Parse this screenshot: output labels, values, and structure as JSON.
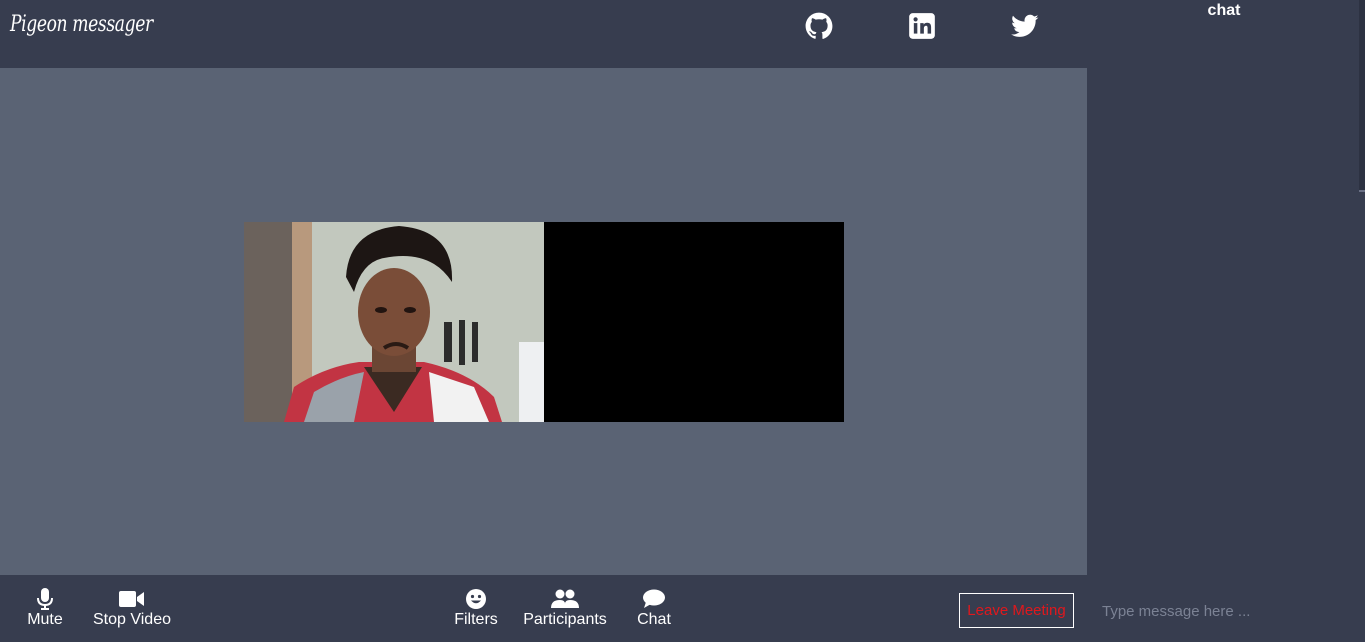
{
  "header": {
    "brand": "Pigeon messager",
    "social": [
      {
        "name": "github-icon"
      },
      {
        "name": "linkedin-icon"
      },
      {
        "name": "twitter-icon"
      }
    ]
  },
  "chat": {
    "title": "chat",
    "placeholder": "Type message here ..."
  },
  "toolbar": {
    "mute_label": "Mute",
    "stop_video_label": "Stop Video",
    "filters_label": "Filters",
    "participants_label": "Participants",
    "chat_label": "Chat",
    "leave_label": "Leave Meeting"
  },
  "colors": {
    "background": "#373d4f",
    "stage": "#5a6374",
    "leave_text": "#e0181d",
    "remote_video": "#000000"
  }
}
